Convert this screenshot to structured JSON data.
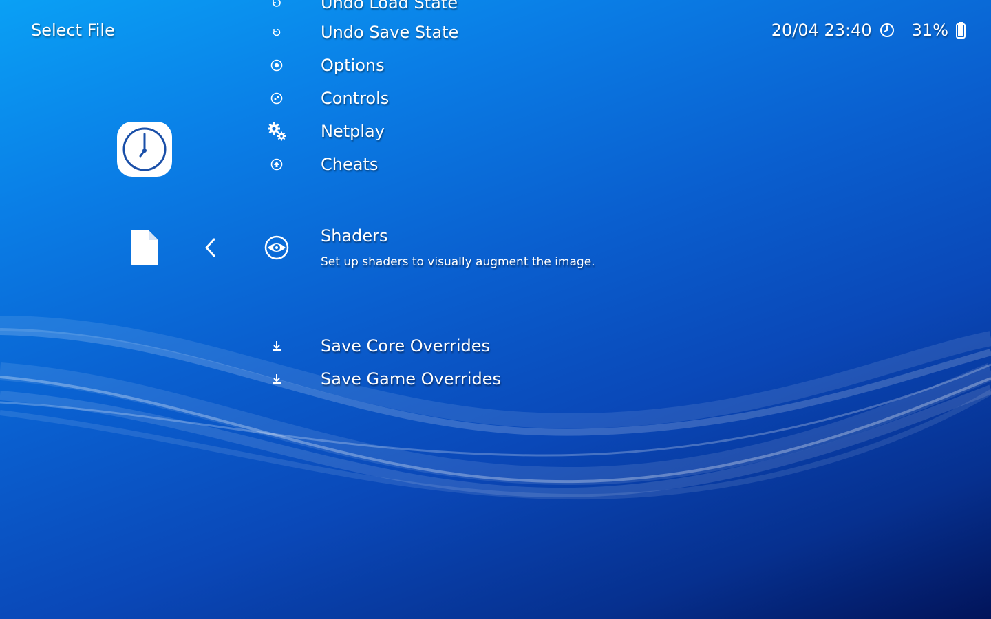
{
  "header": {
    "title": "Select File"
  },
  "status": {
    "datetime": "20/04 23:40",
    "clock_icon": "clock-icon",
    "battery_percent": "31%",
    "battery_icon": "battery-icon"
  },
  "sidebar": {
    "history_icon": "history-clock-icon",
    "file_icon": "file-icon",
    "back_icon": "chevron-left-icon"
  },
  "menu": {
    "items": [
      {
        "label": "Undo Load State",
        "icon": "undo-icon"
      },
      {
        "label": "Undo Save State",
        "icon": "undo-icon"
      },
      {
        "label": "Options",
        "icon": "options-icon"
      },
      {
        "label": "Controls",
        "icon": "gamepad-icon"
      },
      {
        "label": "Netplay",
        "icon": "gears-icon"
      },
      {
        "label": "Cheats",
        "icon": "cheats-icon"
      },
      {
        "label": "Shaders",
        "icon": "eye-icon",
        "sublabel": "Set up shaders to visually augment the image."
      },
      {
        "label": "Save Core Overrides",
        "icon": "download-icon"
      },
      {
        "label": "Save Game Overrides",
        "icon": "download-icon"
      }
    ]
  },
  "colors": {
    "background_top": "#0aa0f5",
    "background_bottom": "#02145a",
    "text": "#ffffff",
    "icon_accent": "#1a4fa8"
  }
}
